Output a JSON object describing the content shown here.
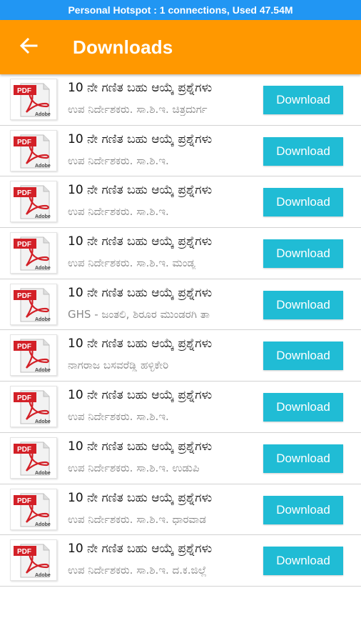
{
  "status_bar": {
    "text": "Personal Hotspot : 1 connections, Used 47.54M"
  },
  "app_bar": {
    "title": "Downloads",
    "back_icon": "arrow-left-icon"
  },
  "colors": {
    "status_bar": "#2196f3",
    "app_bar": "#ff9800",
    "button": "#20bcd5"
  },
  "items": [
    {
      "title": "10 ನೇ ಗಣಿತ ಬಹು ಆಯ್ಕೆ ಪ್ರಶ್ನೆಗಳು",
      "subtitle": "ಉಪ ನಿರ್ದೇಶಕರು. ಸಾ.ಶಿ.ಇ. ಚಿತ್ರದುರ್ಗ",
      "button": "Download",
      "icon": "pdf-adobe-icon"
    },
    {
      "title": "10 ನೇ ಗಣಿತ ಬಹು ಆಯ್ಕೆ ಪ್ರಶ್ನೆಗಳು",
      "subtitle": "ಉಪ ನಿರ್ದೇಶಕರು. ಸಾ.ಶಿ.ಇ.",
      "button": "Download",
      "icon": "pdf-adobe-icon"
    },
    {
      "title": "10 ನೇ ಗಣಿತ ಬಹು ಆಯ್ಕೆ ಪ್ರಶ್ನೆಗಳು",
      "subtitle": "ಉಪ ನಿರ್ದೇಶಕರು. ಸಾ.ಶಿ.ಇ.",
      "button": "Download",
      "icon": "pdf-adobe-icon"
    },
    {
      "title": "10 ನೇ ಗಣಿತ ಬಹು ಆಯ್ಕೆ ಪ್ರಶ್ನೆಗಳು",
      "subtitle": "ಉಪ ನಿರ್ದೇಶಕರು. ಸಾ.ಶಿ.ಇ. ಮಂಡ್ಯ",
      "button": "Download",
      "icon": "pdf-adobe-icon"
    },
    {
      "title": "10 ನೇ ಗಣಿತ ಬಹು ಆಯ್ಕೆ ಪ್ರಶ್ನೆಗಳು",
      "subtitle": "GHS - ಜಂತಲಿ, ಶಿರೂರ ಮುಂಡರಗಿ ತಾ",
      "button": "Download",
      "icon": "pdf-adobe-icon"
    },
    {
      "title": "10 ನೇ ಗಣಿತ ಬಹು ಆಯ್ಕೆ ಪ್ರಶ್ನೆಗಳು",
      "subtitle": "ನಾಗರಾಜ ಬಸವರೆಡ್ಡಿ ಹಳ್ಳಿಕೇರಿ",
      "button": "Download",
      "icon": "pdf-adobe-icon"
    },
    {
      "title": "10 ನೇ ಗಣಿತ ಬಹು ಆಯ್ಕೆ ಪ್ರಶ್ನೆಗಳು",
      "subtitle": "ಉಪ ನಿರ್ದೇಶಕರು. ಸಾ.ಶಿ.ಇ.",
      "button": "Download",
      "icon": "pdf-adobe-icon"
    },
    {
      "title": "10 ನೇ ಗಣಿತ ಬಹು ಆಯ್ಕೆ ಪ್ರಶ್ನೆಗಳು",
      "subtitle": "ಉಪ ನಿರ್ದೇಶಕರು. ಸಾ.ಶಿ.ಇ. ಉಡುಪಿ",
      "button": "Download",
      "icon": "pdf-adobe-icon"
    },
    {
      "title": "10 ನೇ ಗಣಿತ ಬಹು ಆಯ್ಕೆ ಪ್ರಶ್ನೆಗಳು",
      "subtitle": "ಉಪ ನಿರ್ದೇಶಕರು. ಸಾ.ಶಿ.ಇ. ಧಾರವಾಡ",
      "button": "Download",
      "icon": "pdf-adobe-icon"
    },
    {
      "title": "10 ನೇ ಗಣಿತ ಬಹು ಆಯ್ಕೆ ಪ್ರಶ್ನೆಗಳು",
      "subtitle": "ಉಪ ನಿರ್ದೇಶಕರು. ಸಾ.ಶಿ.ಇ. ದ.ಕ.ಜಿಲ್ಲೆ",
      "button": "Download",
      "icon": "pdf-adobe-icon"
    }
  ]
}
